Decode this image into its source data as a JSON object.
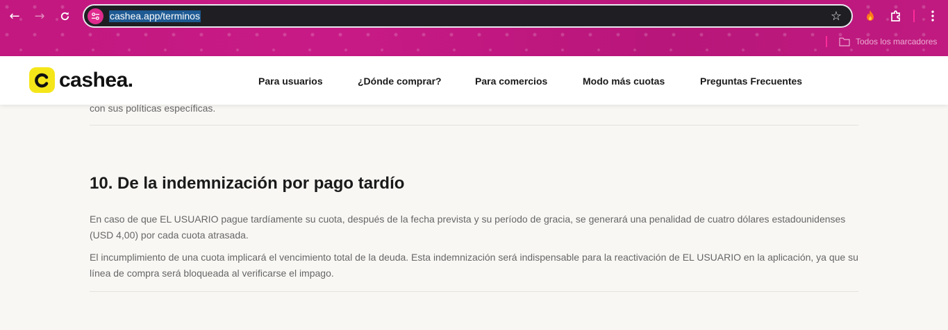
{
  "browser": {
    "url": "cashea.app/terminos",
    "bookmarks_folder_label": "Todos los marcadores",
    "icons": {
      "back": "arrow-left-icon",
      "forward": "arrow-right-icon",
      "reload": "reload-icon",
      "site_info": "tune-icon",
      "bookmark": "star-icon",
      "extension": "fire-extension-icon",
      "extensions_menu": "puzzle-icon",
      "menu": "kebab-menu-icon"
    },
    "accent_color": "#c2187f"
  },
  "site": {
    "logo_text": "cashea.",
    "logo_color": "#f5e61a",
    "nav": [
      {
        "label": "Para usuarios"
      },
      {
        "label": "¿Dónde comprar?"
      },
      {
        "label": "Para comercios"
      },
      {
        "label": "Modo más cuotas"
      },
      {
        "label": "Preguntas Frecuentes"
      }
    ]
  },
  "content": {
    "previous_fragment": "con sus políticas específicas.",
    "section_title": "10. De la indemnización por pago tardío",
    "paragraphs": [
      "En caso de que EL USUARIO pague tardíamente su cuota, después de la fecha prevista y su período de gracia, se generará una penalidad de cuatro dólares estadounidenses (USD 4,00) por cada cuota atrasada.",
      "El incumplimiento de una cuota implicará el vencimiento total de la deuda. Esta indemnización será indispensable para la reactivación de EL USUARIO en la aplicación, ya que su línea de compra será bloqueada al verificarse el impago."
    ]
  }
}
